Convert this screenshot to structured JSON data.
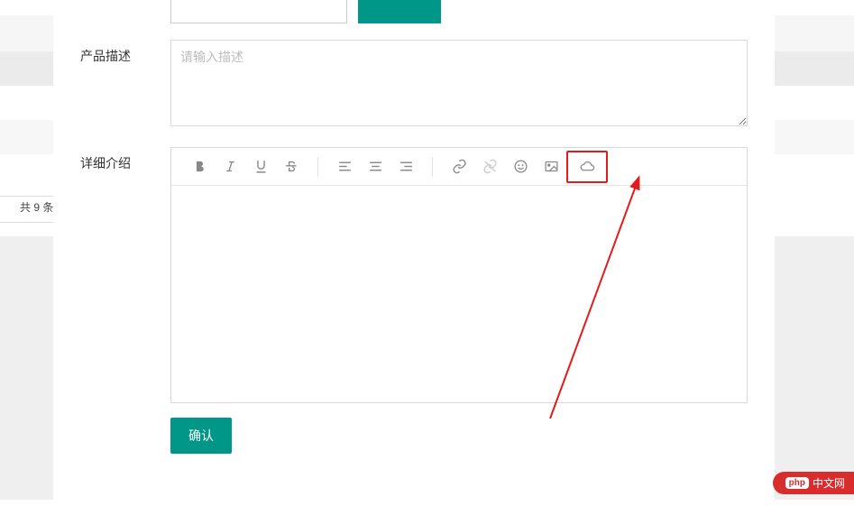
{
  "background": {
    "count_text": "共 9 条"
  },
  "form": {
    "desc_label": "产品描述",
    "desc_placeholder": "请输入描述",
    "detail_label": "详细介绍",
    "confirm_label": "确认"
  },
  "toolbar": {
    "icons": {
      "bold": "bold-icon",
      "italic": "italic-icon",
      "underline": "underline-icon",
      "strike": "strikethrough-icon",
      "align_left": "align-left-icon",
      "align_center": "align-center-icon",
      "align_right": "align-right-icon",
      "link": "link-icon",
      "unlink": "unlink-icon",
      "emoji": "smile-icon",
      "image": "image-icon",
      "cloud": "cloud-icon"
    }
  },
  "watermark": {
    "prefix": "php",
    "text": "中文网"
  },
  "colors": {
    "teal": "#009688",
    "highlight": "#e21c1c",
    "arrow": "#e21c1c",
    "watermark": "#d92c2c"
  }
}
